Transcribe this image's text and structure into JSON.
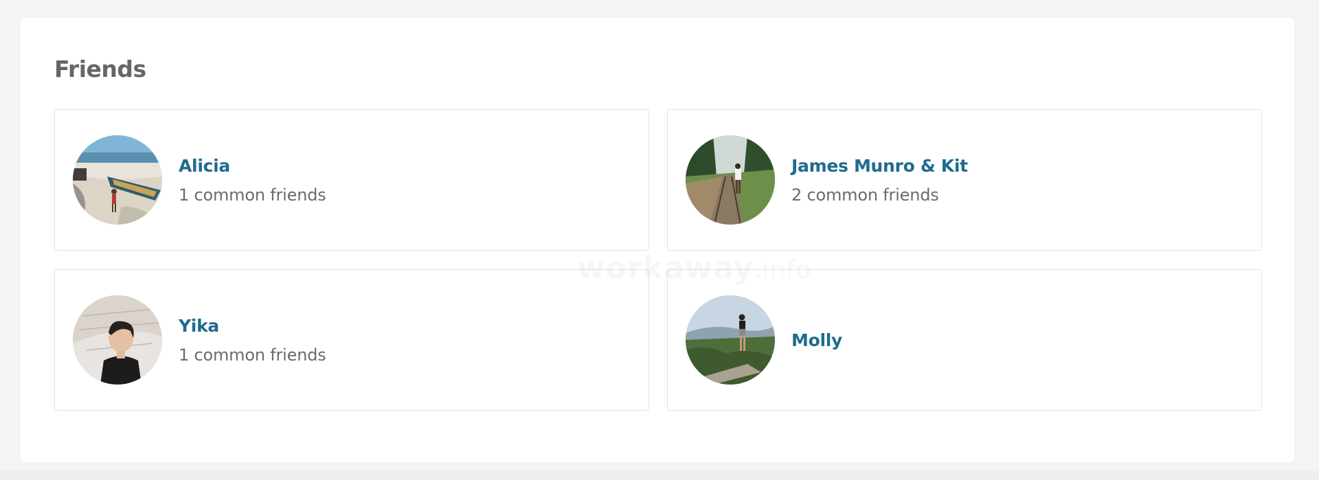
{
  "section": {
    "title": "Friends"
  },
  "friends": [
    {
      "name": "Alicia",
      "common": "1 common friends",
      "avatar_icon": "photo-beach-avatar"
    },
    {
      "name": "James Munro & Kit",
      "common": "2 common friends",
      "avatar_icon": "photo-railway-avatar"
    },
    {
      "name": "Yika",
      "common": "1 common friends",
      "avatar_icon": "photo-portrait-avatar"
    },
    {
      "name": "Molly",
      "common": "",
      "avatar_icon": "photo-hilltop-avatar"
    }
  ],
  "watermark": {
    "main": "workaway",
    "suffix": ".info"
  },
  "colors": {
    "link": "#1f6b8e",
    "muted_text": "#6b6b6b",
    "title": "#666666",
    "border": "#e3e3e3",
    "page_bg": "#f4f4f4"
  }
}
